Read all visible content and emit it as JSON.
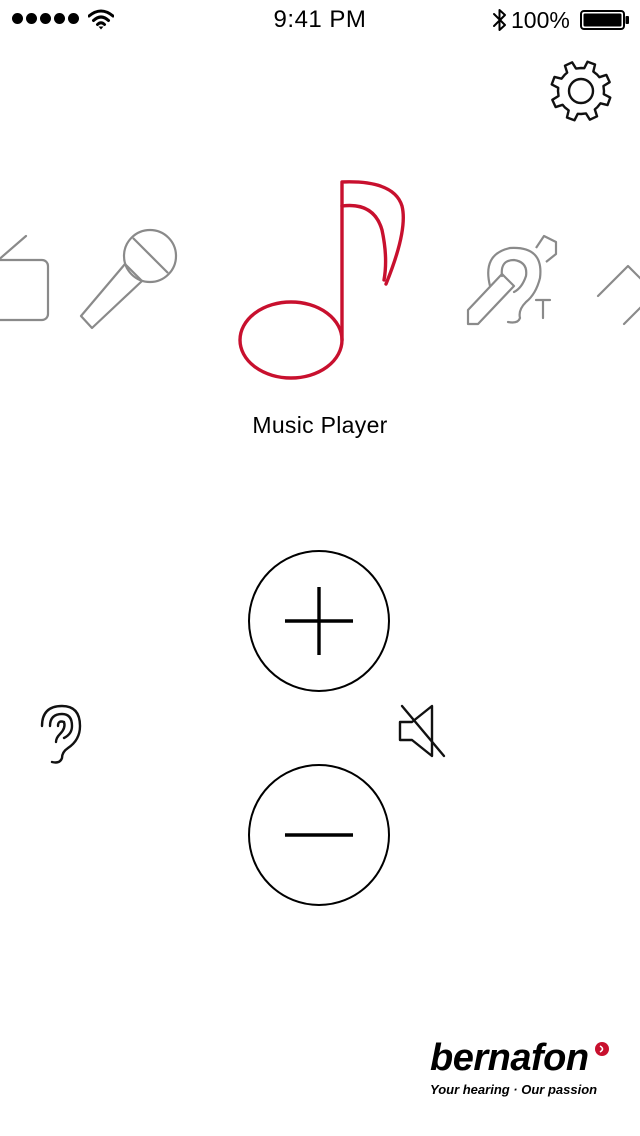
{
  "status_bar": {
    "time": "9:41 PM",
    "battery_percent": "100%",
    "signal_bars": 5
  },
  "settings": {
    "icon": "gear-icon"
  },
  "programs": {
    "items": [
      {
        "icon": "radio-icon"
      },
      {
        "icon": "microphone-icon"
      },
      {
        "icon": "music-note-icon",
        "label": "Music Player",
        "selected": true
      },
      {
        "icon": "telecoil-icon"
      },
      {
        "icon": "tv-icon"
      }
    ],
    "selected_label": "Music Player"
  },
  "volume": {
    "up_icon": "plus-icon",
    "down_icon": "minus-icon"
  },
  "ear_control": {
    "icon": "ear-icon"
  },
  "mute_control": {
    "icon": "speaker-muted-icon"
  },
  "brand": {
    "name": "bernafon",
    "tagline": "Your hearing · Our passion"
  },
  "colors": {
    "accent": "#c8102e",
    "icon_gray": "#8a8a8a",
    "text": "#000000",
    "background": "#ffffff"
  }
}
